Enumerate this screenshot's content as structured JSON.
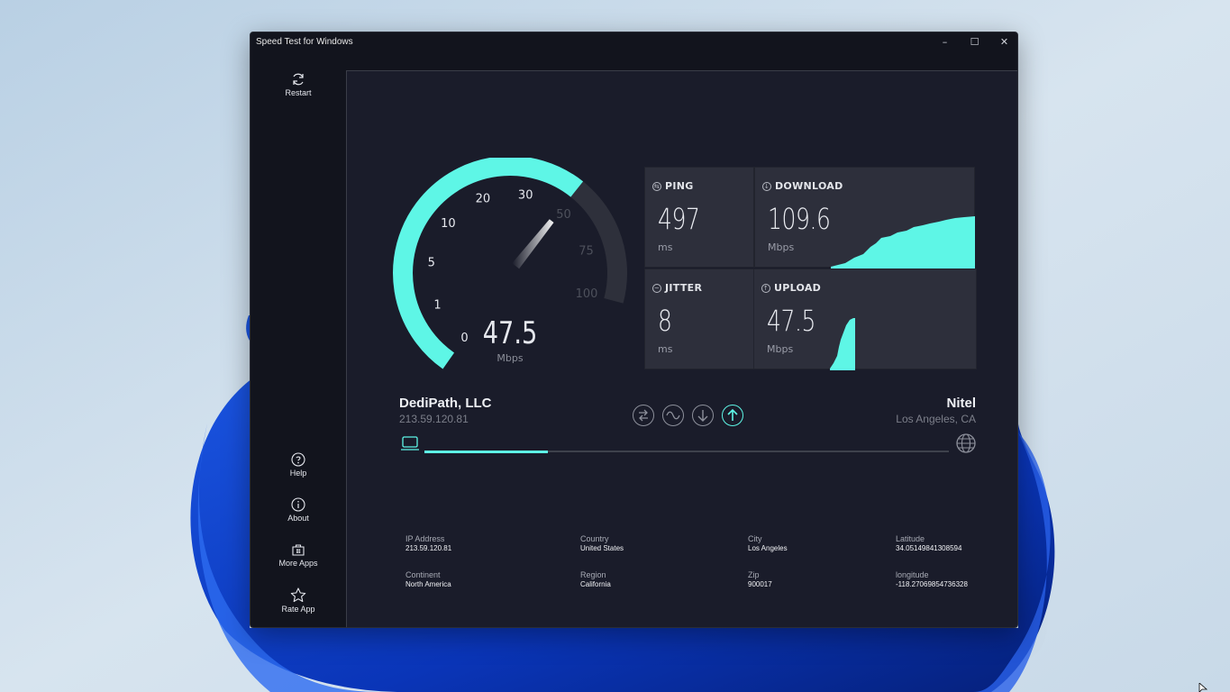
{
  "window": {
    "title": "Speed Test for Windows"
  },
  "titlebar": {
    "minimize": "–",
    "maximize": "☐",
    "close": "✕"
  },
  "sidebar": {
    "restart": "Restart",
    "help": "Help",
    "about": "About",
    "more_apps": "More Apps",
    "rate_app": "Rate App"
  },
  "gauge": {
    "value": "47.5",
    "unit": "Mbps",
    "ticks": [
      "0",
      "1",
      "5",
      "10",
      "20",
      "30",
      "50",
      "75",
      "100"
    ],
    "needle_value": 47.5
  },
  "stats": {
    "ping": {
      "label": "PING",
      "value": "497",
      "unit": "ms"
    },
    "download": {
      "label": "DOWNLOAD",
      "value": "109.6",
      "unit": "Mbps"
    },
    "jitter": {
      "label": "JITTER",
      "value": "8",
      "unit": "ms"
    },
    "upload": {
      "label": "UPLOAD",
      "value": "47.5",
      "unit": "Mbps"
    }
  },
  "client": {
    "isp": "DediPath, LLC",
    "ip": "213.59.120.81"
  },
  "server": {
    "name": "Nitel",
    "location": "Los Angeles, CA"
  },
  "phases": [
    "ping",
    "jitter",
    "download",
    "upload"
  ],
  "active_phase": "upload",
  "progress": 0.235,
  "info": {
    "ip_label": "IP Address",
    "ip_value": "213.59.120.81",
    "country_label": "Country",
    "country_value": "United States",
    "city_label": "City",
    "city_value": "Los Angeles",
    "lat_label": "Latitude",
    "lat_value": "34.05149841308594",
    "continent_label": "Continent",
    "continent_value": "North America",
    "region_label": "Region",
    "region_value": "California",
    "zip_label": "Zip",
    "zip_value": "900017",
    "lon_label": "longitude",
    "lon_value": "-118.27069854736328"
  },
  "colors": {
    "accent": "#5ef6e6",
    "track": "#2e303b",
    "bg": "#1a1c2a"
  }
}
